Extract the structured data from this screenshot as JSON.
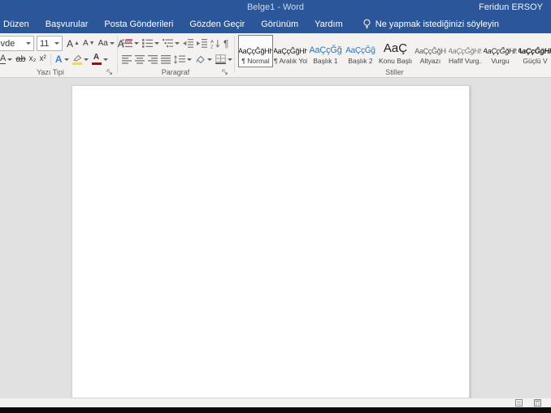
{
  "titlebar": {
    "title": "Belge1  -  Word",
    "user": "Feridun ERSOY"
  },
  "menubar": {
    "tabs": [
      "Düzen",
      "Başvurular",
      "Posta Gönderileri",
      "Gözden Geçir",
      "Görünüm",
      "Yardım"
    ],
    "tellme": "Ne yapmak istediğinizi söyleyin"
  },
  "ribbon": {
    "font": {
      "group_label": "Yazı Tipi",
      "name_value": "Gövde",
      "size_value": "11",
      "grow": "A",
      "shrink": "A",
      "change_case": "Aa",
      "clear": "A",
      "underline": "A",
      "strike": "ab",
      "subscript": "x₂",
      "superscript": "x²",
      "effects": "A",
      "color": "A"
    },
    "paragraph": {
      "group_label": "Paragraf",
      "sort_a": "A",
      "sort_z": "Z",
      "pilcrow": "¶"
    },
    "styles": {
      "group_label": "Stiller",
      "items": [
        {
          "preview": "AaÇçĞğHh",
          "name": "¶ Normal"
        },
        {
          "preview": "AaÇçĞğHh",
          "name": "¶ Aralık Yok"
        },
        {
          "preview": "AaÇçĞğ",
          "name": "Başlık 1"
        },
        {
          "preview": "AaÇçĞğ",
          "name": "Başlık 2"
        },
        {
          "preview": "AaÇ",
          "name": "Konu Başlı..."
        },
        {
          "preview": "AaÇçĞğH",
          "name": "Altyazı"
        },
        {
          "preview": "AaÇçĞğHh",
          "name": "Hafif Vurg..."
        },
        {
          "preview": "AaÇçĞğHh",
          "name": "Vurgu"
        },
        {
          "preview": "AaÇçĞğHh",
          "name": "Güçlü V"
        }
      ]
    }
  },
  "colors": {
    "brand_blue": "#2b579a",
    "heading_blue": "#2e74b5",
    "highlight_yellow": "#f7e11b",
    "font_color_red": "#c00000"
  }
}
